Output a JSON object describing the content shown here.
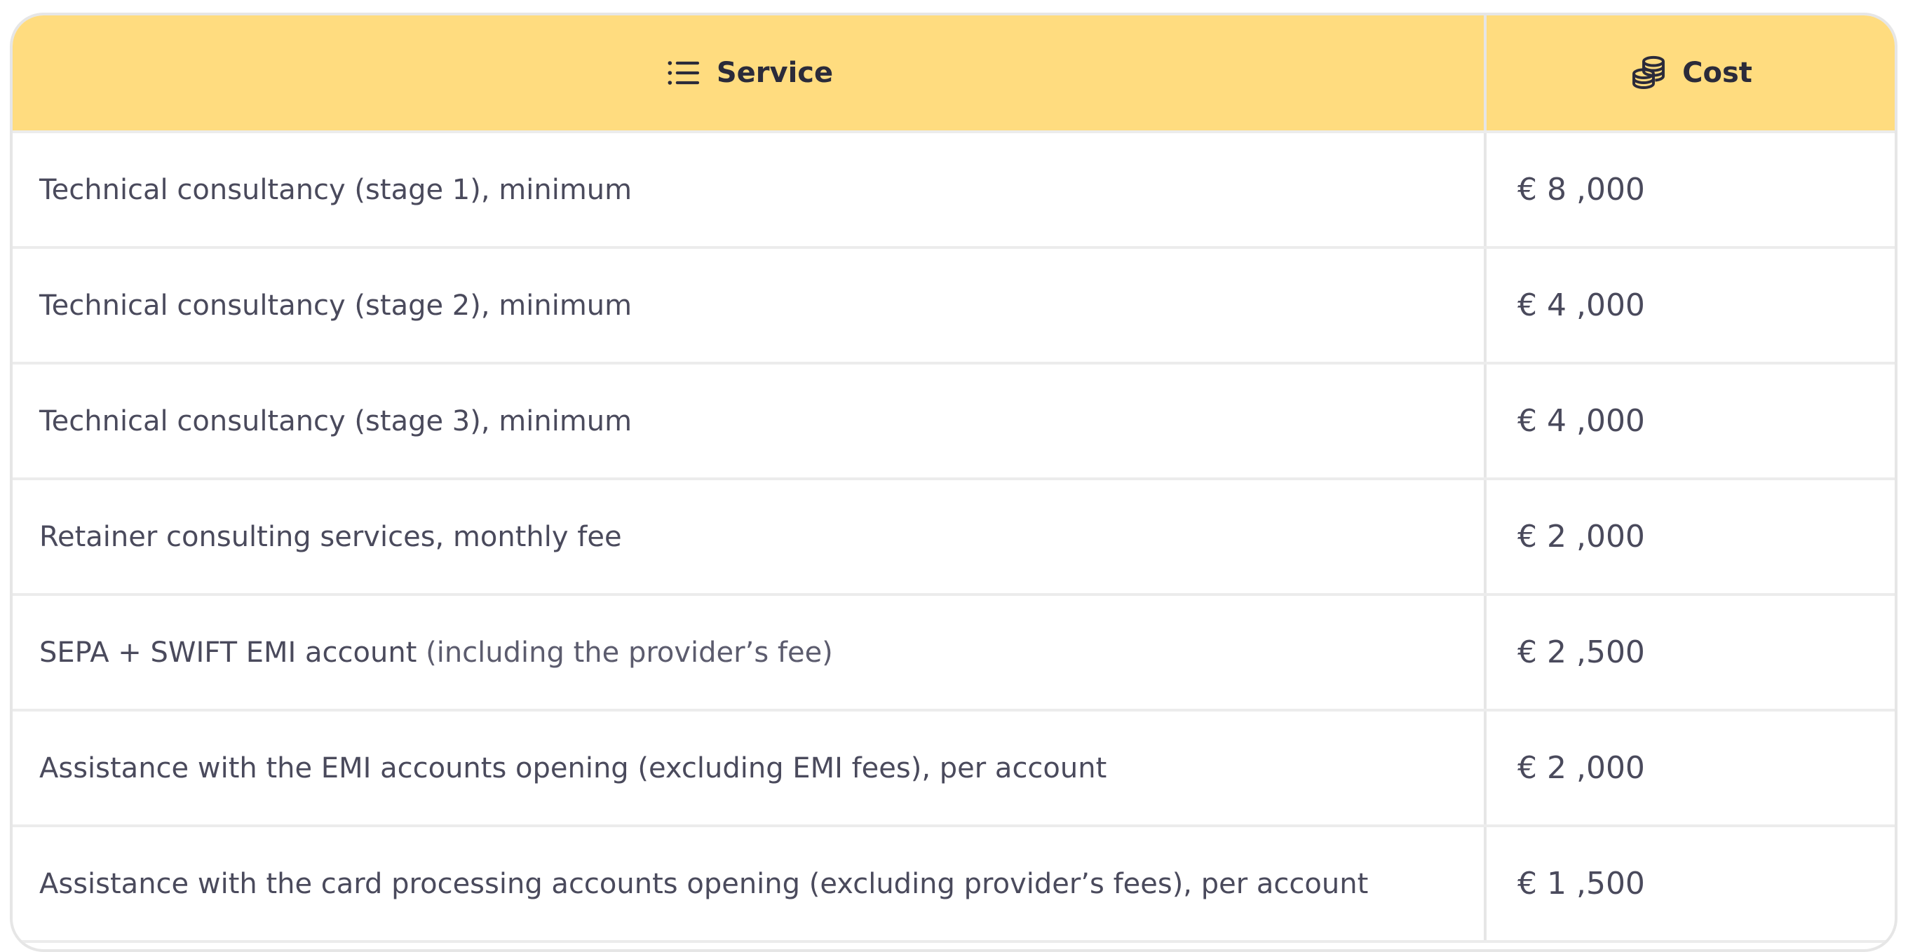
{
  "table": {
    "headers": {
      "service": {
        "label": "Service",
        "icon": "list-icon"
      },
      "cost": {
        "label": "Cost",
        "icon": "coins-icon"
      }
    },
    "rows": [
      {
        "service": "Technical consultancy (stage 1), minimum",
        "service_extra": "",
        "cost": "€ 8 ,000"
      },
      {
        "service": "Technical consultancy (stage 2), minimum",
        "service_extra": "",
        "cost": "€ 4 ,000"
      },
      {
        "service": "Technical consultancy (stage 3), minimum",
        "service_extra": "",
        "cost": "€ 4 ,000"
      },
      {
        "service": "Retainer consulting services, monthly fee",
        "service_extra": "",
        "cost": "€ 2 ,000"
      },
      {
        "service": "SEPA + SWIFT EMI account",
        "service_extra": " (including the provider’s fee)",
        "cost": "€ 2 ,500"
      },
      {
        "service": "Assistance with the EMI accounts opening (excluding EMI fees), per account",
        "service_extra": "",
        "cost": "€ 2 ,000"
      },
      {
        "service": "Assistance with the card processing accounts opening (excluding provider’s fees), per account",
        "service_extra": "",
        "cost": "€ 1 ,500"
      }
    ],
    "colors": {
      "header_bg": "#ffdc7f",
      "header_text": "#2b2b3a",
      "body_text": "#4a4a5c",
      "border": "#e6e6e6"
    }
  }
}
